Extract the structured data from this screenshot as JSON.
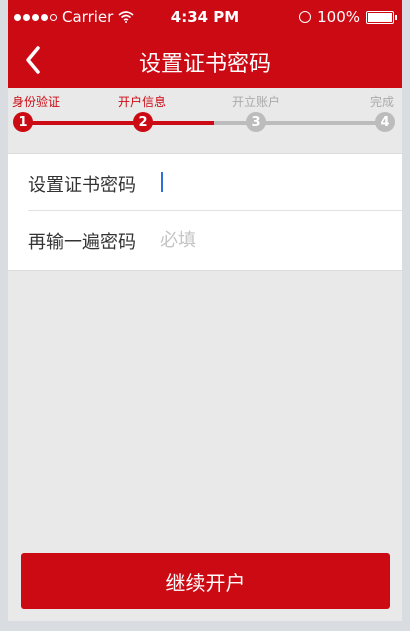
{
  "status_bar": {
    "carrier": "Carrier",
    "time": "4:34 PM",
    "battery": "100%"
  },
  "nav": {
    "title": "设置证书密码",
    "back_icon": "chevron-left-icon"
  },
  "steps": [
    {
      "label": "身份验证",
      "number": "1",
      "state": "done"
    },
    {
      "label": "开户信息",
      "number": "2",
      "state": "current"
    },
    {
      "label": "开立账户",
      "number": "3",
      "state": "pending"
    },
    {
      "label": "完成",
      "number": "4",
      "state": "pending"
    }
  ],
  "form": {
    "password": {
      "label": "设置证书密码",
      "value": "",
      "placeholder": ""
    },
    "confirm": {
      "label": "再输一遍密码",
      "value": "",
      "placeholder": "必填"
    }
  },
  "submit_label": "继续开户",
  "colors": {
    "brand": "#cc0a14",
    "inactive": "#bcbcbc"
  }
}
